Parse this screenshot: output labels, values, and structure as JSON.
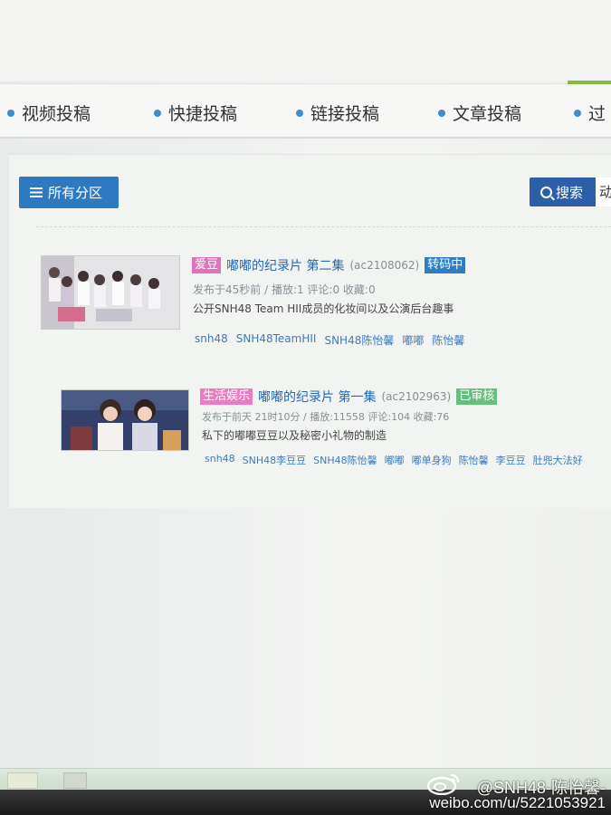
{
  "nav": {
    "items": [
      "视频投稿",
      "快捷投稿",
      "链接投稿",
      "文章投稿",
      "过"
    ]
  },
  "toolbar": {
    "categories_label": "所有分区",
    "search_label": "搜索",
    "extra_label": "动"
  },
  "videos": [
    {
      "tag": "爱豆",
      "tag_color": "#e271b9",
      "title": "嘟嘟的纪录片 第二集",
      "acid": "(ac2108062)",
      "status": "转码中",
      "status_color": "#2f7ec4",
      "meta": "发布于45秒前 / 播放:1 评论:0 收藏:0",
      "description": "公开SNH48 Team HII成员的化妆间以及公演后台趣事",
      "tags": [
        "snh48",
        "SNH48TeamHII",
        "SNH48陈怡馨",
        "嘟嘟",
        "陈怡馨"
      ]
    },
    {
      "tag": "生活娱乐",
      "tag_color": "#e87dc2",
      "title": "嘟嘟的纪录片 第一集",
      "acid": "(ac2102963)",
      "status": "已审核",
      "status_color": "#6bbf7e",
      "meta": "发布于前天 21时10分 / 播放:11558 评论:104 收藏:76",
      "description": "私下的嘟嘟豆豆以及秘密小礼物的制造",
      "tags": [
        "snh48",
        "SNH48李豆豆",
        "SNH48陈怡馨",
        "嘟嘟",
        "嘟单身狗",
        "陈怡馨",
        "李豆豆",
        "肚兜大法好"
      ]
    }
  ],
  "watermark": {
    "handle": "@SNH48-陈怡馨-",
    "url": "weibo.com/u/5221053921"
  }
}
